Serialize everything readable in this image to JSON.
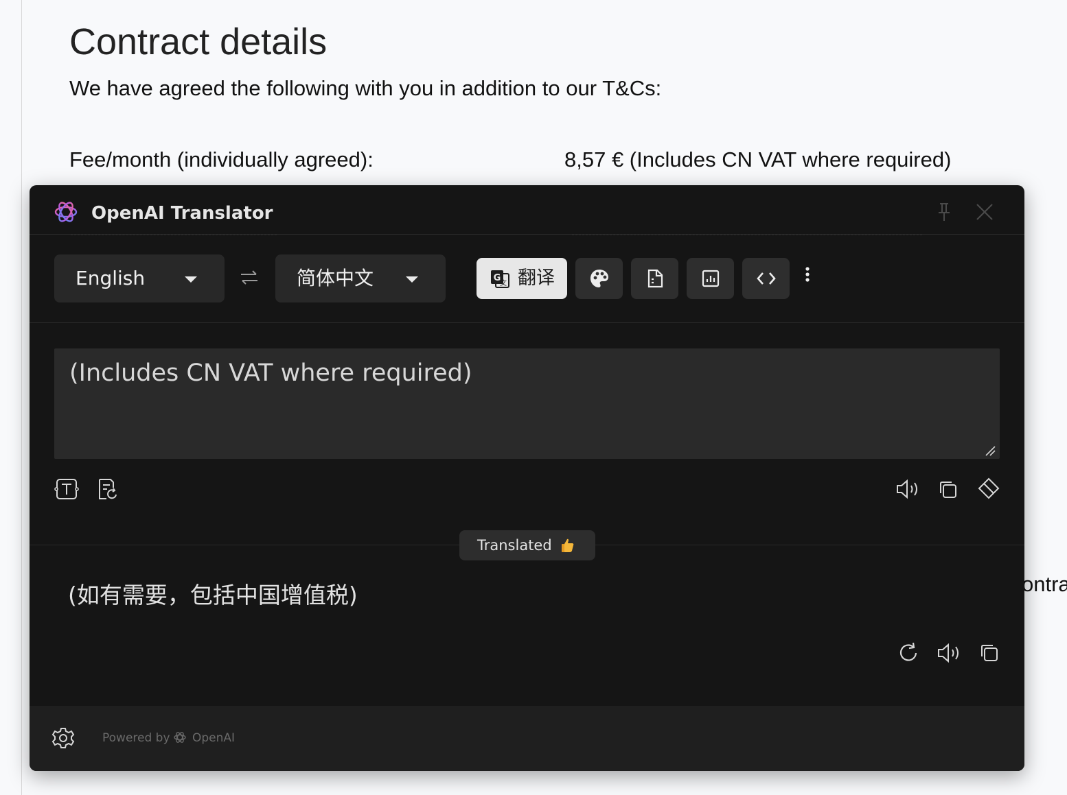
{
  "page": {
    "title": "Contract details",
    "intro": "We have agreed the following with you in addition to our T&Cs:",
    "fee_label": "Fee/month (individually agreed):",
    "fee_value": "8,57 € (Includes CN VAT where required)",
    "partial_text": "ontra"
  },
  "translator": {
    "title": "OpenAI Translator",
    "source_language": "English",
    "target_language": "简体中文",
    "translate_button_label": "翻译",
    "source_text": "(Includes CN VAT where required)",
    "status_text": "Translated",
    "status_emoji": "👍",
    "result_text": "(如有需要，包括中国增值税)",
    "footer": {
      "powered_by": "Powered by",
      "brand": "OpenAI"
    },
    "colors": {
      "panel_bg": "#151515",
      "control_bg": "#282828",
      "translate_button_bg": "#e7e7e7",
      "text_primary": "#e8e8e8"
    }
  }
}
